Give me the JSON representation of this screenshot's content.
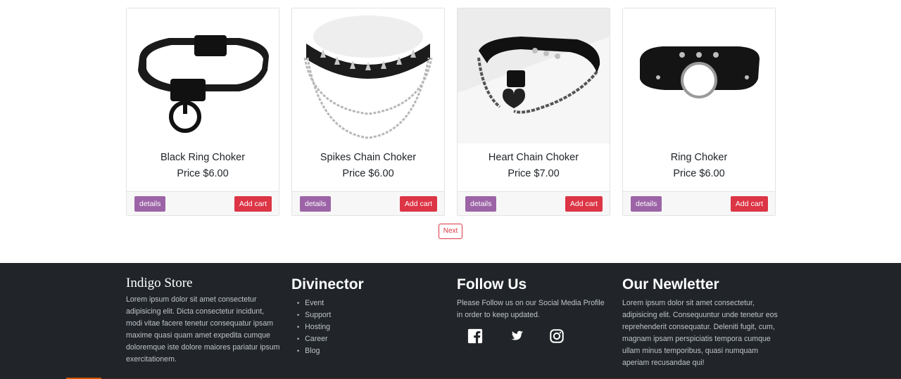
{
  "products": [
    {
      "name": "Black Ring Choker",
      "price": "Price $6.00",
      "details_label": "details",
      "cart_label": "Add cart"
    },
    {
      "name": "Spikes Chain Choker",
      "price": "Price $6.00",
      "details_label": "details",
      "cart_label": "Add cart"
    },
    {
      "name": "Heart Chain Choker",
      "price": "Price $7.00",
      "details_label": "details",
      "cart_label": "Add cart"
    },
    {
      "name": "Ring Choker",
      "price": "Price $6.00",
      "details_label": "details",
      "cart_label": "Add cart"
    }
  ],
  "pagination": {
    "next_label": "Next"
  },
  "footer": {
    "store": {
      "title": "Indigo Store",
      "text": "Lorem ipsum dolor sit amet consectetur adipisicing elit. Dicta consectetur incidunt, modi vitae facere tenetur consequatur ipsam maxime quasi quam amet expedita cumque doloremque iste dolore maiores pariatur ipsum exercitationem."
    },
    "links": {
      "title": "Divinector",
      "items": [
        "Event",
        "Support",
        "Hosting",
        "Career",
        "Blog"
      ]
    },
    "follow": {
      "title": "Follow Us",
      "text": "Please Follow us on our Social Media Profile in order to keep updated.",
      "icons": [
        "facebook-icon",
        "twitter-icon",
        "instagram-icon"
      ]
    },
    "newsletter": {
      "title": "Our Newletter",
      "text": "Lorem ipsum dolor sit amet consectetur, adipisicing elit. Consequuntur unde tenetur eos reprehenderit consequatur. Deleniti fugit, cum, magnam ipsam perspiciatis tempora cumque ullam minus temporibus, quasi numquam aperiam recusandae qui!"
    }
  },
  "colors": {
    "details": "#9c64a6",
    "cart": "#dc3545",
    "footer_bg": "#212529",
    "accent": "#d35400"
  }
}
